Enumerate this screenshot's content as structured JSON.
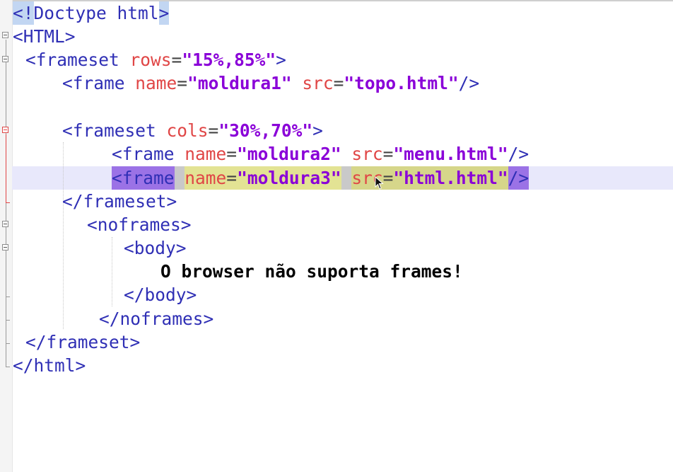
{
  "editor": {
    "lines": [
      {
        "indent": "",
        "doctype_open": "<!",
        "doctype_text": "Doctype html",
        "doctype_close": ">"
      },
      {
        "text": "<HTML>"
      },
      {
        "tag": "<frameset",
        "attr": "rows",
        "eq": "=",
        "val": "\"15%,85%\"",
        "close": ">"
      },
      {
        "tag": "<frame",
        "attr1": "name",
        "eq": "=",
        "val1": "\"moldura1\"",
        "attr2": "src",
        "val2": "\"topo.html\"",
        "close": "/>"
      },
      {
        "tag": "<frameset",
        "attr": "cols",
        "eq": "=",
        "val": "\"30%,70%\"",
        "close": ">"
      },
      {
        "tag": "<frame",
        "attr1": "name",
        "eq": "=",
        "val1": "\"moldura2\"",
        "attr2": "src",
        "val2": "\"menu.html\"",
        "close": "/>"
      },
      {
        "tag": "<frame",
        "attr1": "name",
        "eq": "=",
        "val1": "\"moldura3\"",
        "attr2": "src",
        "val2": "\"html.html\"",
        "close": "/>"
      },
      {
        "text": "</frameset>"
      },
      {
        "text": "<noframes>"
      },
      {
        "text": "<body>"
      },
      {
        "text": "O browser não suporta frames!"
      },
      {
        "text": "</body>"
      },
      {
        "text": "</noframes>"
      },
      {
        "text": "</frameset>"
      },
      {
        "text": "</html>"
      }
    ]
  },
  "colors": {
    "tag": "#2f2fb5",
    "attribute": "#e04646",
    "value": "#8a00d8",
    "current_line": "#e8e8fb"
  },
  "icons": [
    "fold-minus-icon",
    "mouse-cursor-icon"
  ]
}
